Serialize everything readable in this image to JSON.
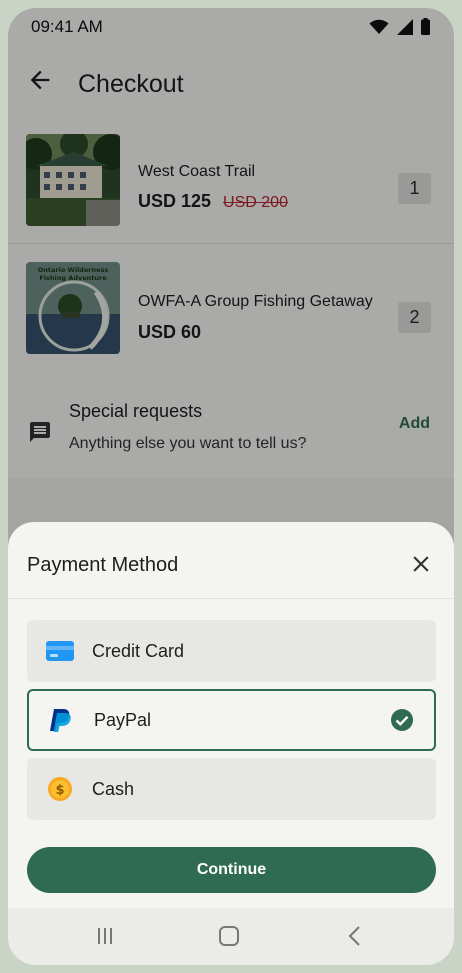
{
  "status_bar": {
    "time": "09:41 AM"
  },
  "header": {
    "title": "Checkout"
  },
  "order_items": [
    {
      "name": "West Coast Trail",
      "price": "USD 125",
      "old_price": "USD 200",
      "quantity": "1"
    },
    {
      "name": "OWFA-A Group Fishing Getaway",
      "price": "USD 60",
      "quantity": "2",
      "thumb_text": "Ontario Wilderness Fishing Adventure"
    }
  ],
  "special_requests": {
    "title": "Special requests",
    "subtitle": "Anything else you want to tell us?",
    "action": "Add"
  },
  "payment_sheet": {
    "title": "Payment Method",
    "options": [
      {
        "label": "Credit Card",
        "icon": "credit-card-icon",
        "selected": false
      },
      {
        "label": "PayPal",
        "icon": "paypal-icon",
        "selected": true
      },
      {
        "label": "Cash",
        "icon": "cash-coin-icon",
        "selected": false
      }
    ],
    "continue_label": "Continue"
  },
  "colors": {
    "accent": "#2f6b52",
    "strike_price": "#b3242e",
    "sheet_bg": "#f4f4f1"
  }
}
